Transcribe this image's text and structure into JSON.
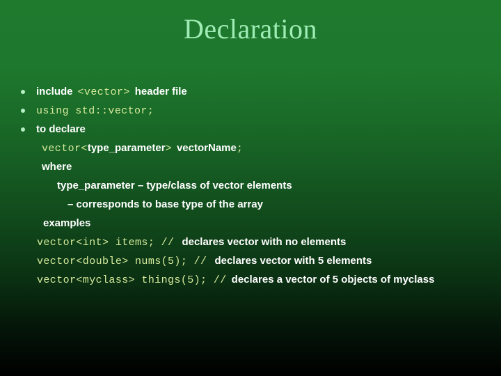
{
  "slide": {
    "title": "Declaration",
    "background_top_color": "#1f7a2e",
    "background_bottom_color": "#000000",
    "title_color": "#9fecb5",
    "body_text_color": "#ffffff",
    "code_text_color": "#d6ea9c",
    "bullet_color": "#b5f0c4"
  },
  "bullets": [
    {
      "marker": true,
      "runs": [
        {
          "style": "sans",
          "text": "include"
        },
        {
          "style": "space",
          "text": " "
        },
        {
          "style": "mono",
          "text": "<vector>"
        },
        {
          "style": "space",
          "text": " "
        },
        {
          "style": "sans",
          "text": "header file"
        }
      ]
    },
    {
      "marker": true,
      "runs": [
        {
          "style": "mono",
          "text": "using std::vector;"
        }
      ]
    },
    {
      "marker": true,
      "runs": [
        {
          "style": "sans",
          "text": "to declare"
        }
      ]
    }
  ],
  "sub_lines": [
    {
      "indent": "i1",
      "runs": [
        {
          "style": "mono",
          "text": "vector"
        },
        {
          "style": "mono",
          "text": "<"
        },
        {
          "style": "sans",
          "text": "type_parameter"
        },
        {
          "style": "mono",
          "text": ">"
        },
        {
          "style": "space",
          "text": " "
        },
        {
          "style": "sans",
          "text": "vectorName"
        },
        {
          "style": "mono",
          "text": ";"
        }
      ]
    },
    {
      "indent": "i1",
      "runs": [
        {
          "style": "sans",
          "text": "where"
        }
      ]
    },
    {
      "indent": "i3",
      "runs": [
        {
          "style": "sans",
          "text": "type_parameter – type/class of vector elements"
        }
      ]
    },
    {
      "indent": "i4",
      "runs": [
        {
          "style": "sans",
          "text": "–  corresponds to base type of the array"
        }
      ]
    },
    {
      "indent": "i2",
      "runs": [
        {
          "style": "sans",
          "text": "examples"
        }
      ]
    },
    {
      "indent": "i5",
      "runs": [
        {
          "style": "mono",
          "text": "vector<int> items; //"
        },
        {
          "style": "space2",
          "text": "  "
        },
        {
          "style": "sans",
          "text": "declares vector with no elements"
        }
      ]
    },
    {
      "indent": "i5",
      "runs": [
        {
          "style": "mono",
          "text": "vector<double> nums(5); //"
        },
        {
          "style": "space2",
          "text": "  "
        },
        {
          "style": "sans",
          "text": "declares vector with 5 elements"
        }
      ]
    },
    {
      "indent": "i5",
      "runs": [
        {
          "style": "mono",
          "text": "vector<myclass> things(5); //"
        },
        {
          "style": "space",
          "text": " "
        },
        {
          "style": "sans",
          "text": "declares a vector of 5 objects of myclass"
        }
      ]
    }
  ]
}
